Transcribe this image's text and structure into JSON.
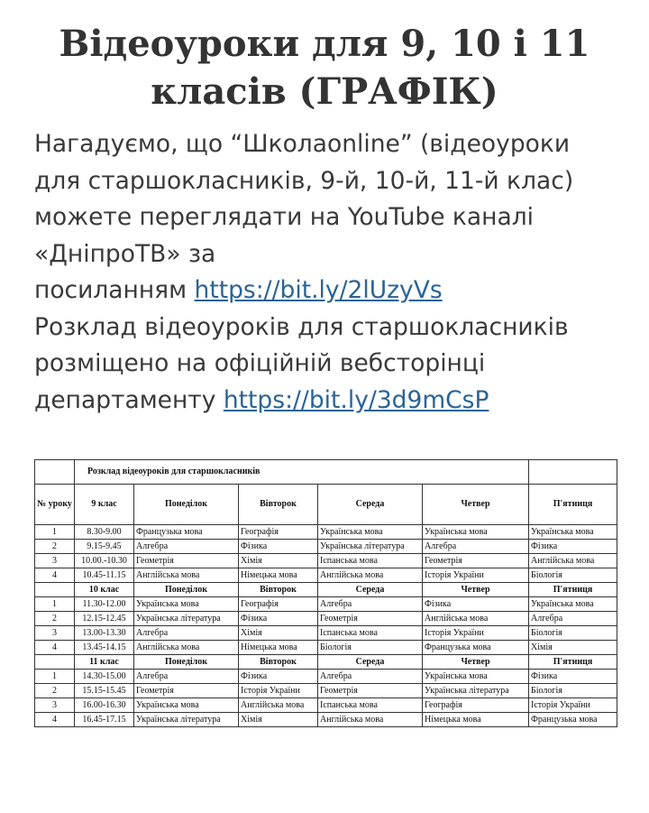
{
  "title_line1": "Відеоуроки для 9, 10 і 11",
  "title_line2": "класів (ГРАФІК)",
  "intro": {
    "line1": "Нагадуємо, що “Школаonline” (відеоуроки",
    "line2": "для старшокласників, 9-й, 10-й, 11-й клас)",
    "line3": "можете переглядати на YouTube каналі",
    "line4": "«ДніпроТВ» за",
    "line5_prefix": "посиланням ",
    "link1": "https://bit.ly/2lUzyVs",
    "line6": "Розклад відеоуроків для старшокласників",
    "line7": "розміщено на офіційній вебсторінці",
    "line8_prefix": "департаменту ",
    "link2": "https://bit.ly/3d9mCsP"
  },
  "schedule": {
    "title": "Розклад відеоуроків для старшокласників",
    "num_header": "№ уроку",
    "day_headers": [
      "Понеділок",
      "Вівторок",
      "Середа",
      "Четвер",
      "П'ятниця"
    ],
    "groups": [
      {
        "grade": "9 клас",
        "rows": [
          {
            "n": "1",
            "time": "8.30-9.00",
            "mon": "Французька мова",
            "tue": "Географія",
            "wed": "Українська мова",
            "thu": "Українська мова",
            "fri": "Українська мова"
          },
          {
            "n": "2",
            "time": "9.15-9.45",
            "mon": "Алгебра",
            "tue": "Фізика",
            "wed": "Українська література",
            "thu": "Алгебра",
            "fri": "Фізика"
          },
          {
            "n": "3",
            "time": "10.00.-10.30",
            "mon": "Геометрія",
            "tue": "Хімія",
            "wed": "Іспанська мова",
            "thu": "Геометрія",
            "fri": "Англійська мова"
          },
          {
            "n": "4",
            "time": "10.45-11.15",
            "mon": "Англійська мова",
            "tue": "Німецька мова",
            "wed": "Англійська мова",
            "thu": "Історія України",
            "fri": "Біологія"
          }
        ]
      },
      {
        "grade": "10 клас",
        "rows": [
          {
            "n": "1",
            "time": "11.30-12.00",
            "mon": "Українська мова",
            "tue": "Географія",
            "wed": "Алгебра",
            "thu": "Фізика",
            "fri": "Українська мова"
          },
          {
            "n": "2",
            "time": "12.15-12.45",
            "mon": "Українська література",
            "tue": "Фізика",
            "wed": "Геометрія",
            "thu": "Англійська мова",
            "fri": "Алгебра"
          },
          {
            "n": "3",
            "time": "13.00-13.30",
            "mon": "Алгебра",
            "tue": "Хімія",
            "wed": "Іспанська мова",
            "thu": "Історія України",
            "fri": "Біологія"
          },
          {
            "n": "4",
            "time": "13.45-14.15",
            "mon": "Англійська мова",
            "tue": "Німецька мова",
            "wed": "Біологія",
            "thu": "Французька мова",
            "fri": "Хімія"
          }
        ]
      },
      {
        "grade": "11 клас",
        "rows": [
          {
            "n": "1",
            "time": "14.30-15.00",
            "mon": "Алгебра",
            "tue": "Фізика",
            "wed": "Алгебра",
            "thu": "Українська мова",
            "fri": "Фізика"
          },
          {
            "n": "2",
            "time": "15.15-15.45",
            "mon": "Геометрія",
            "tue": "Історія України",
            "wed": "Геометрія",
            "thu": "Українська література",
            "fri": "Біологія"
          },
          {
            "n": "3",
            "time": "16.00-16.30",
            "mon": "Українська мова",
            "tue": "Англійська мова",
            "wed": "Іспанська мова",
            "thu": "Географія",
            "fri": "Історія України"
          },
          {
            "n": "4",
            "time": "16.45-17.15",
            "mon": "Українська література",
            "tue": "Хімія",
            "wed": "Англійська мова",
            "thu": "Німецька мова",
            "fri": "Французька мова"
          }
        ]
      }
    ]
  }
}
